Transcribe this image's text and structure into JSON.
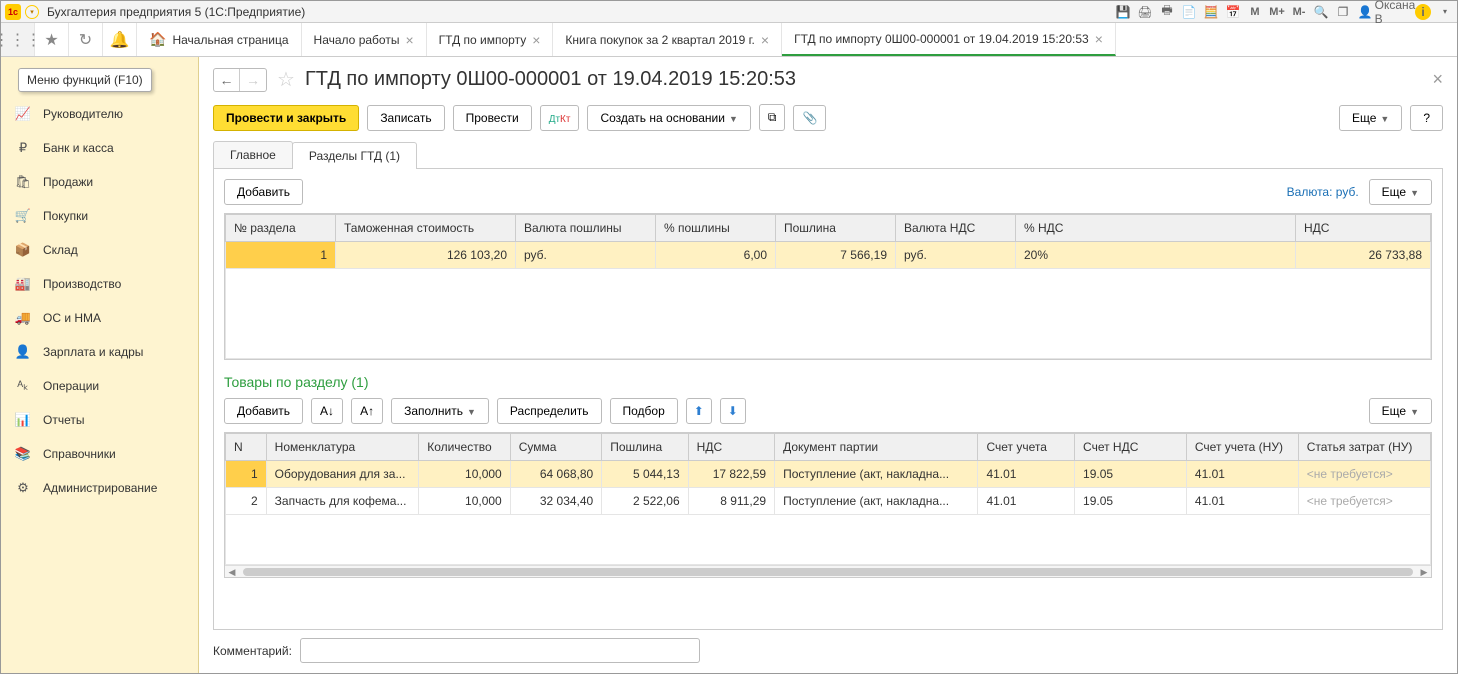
{
  "titlebar": {
    "app_title": "Бухгалтерия предприятия 5   (1С:Предприятие)",
    "user": "Оксана В"
  },
  "tooltip": "Меню функций (F10)",
  "tabs": {
    "home": "Начальная страница",
    "items": [
      {
        "label": "Начало работы"
      },
      {
        "label": "ГТД по импорту"
      },
      {
        "label": "Книга покупок за 2 квартал 2019 г."
      },
      {
        "label": "ГТД по импорту 0Ш00-000001 от 19.04.2019 15:20:53",
        "active": true
      }
    ]
  },
  "sidebar": {
    "items": [
      {
        "icon": "📈",
        "label": "Руководителю"
      },
      {
        "icon": "₽",
        "label": "Банк и касса"
      },
      {
        "icon": "🛍",
        "label": "Продажи"
      },
      {
        "icon": "🛒",
        "label": "Покупки"
      },
      {
        "icon": "📦",
        "label": "Склад"
      },
      {
        "icon": "🏭",
        "label": "Производство"
      },
      {
        "icon": "🚚",
        "label": "ОС и НМА"
      },
      {
        "icon": "👤",
        "label": "Зарплата и кадры"
      },
      {
        "icon": "ᴬₖ",
        "label": "Операции"
      },
      {
        "icon": "📊",
        "label": "Отчеты"
      },
      {
        "icon": "📚",
        "label": "Справочники"
      },
      {
        "icon": "⚙",
        "label": "Администрирование"
      }
    ]
  },
  "document": {
    "title": "ГТД по импорту 0Ш00-000001 от 19.04.2019 15:20:53",
    "actions": {
      "post_close": "Провести и закрыть",
      "save": "Записать",
      "post": "Провести",
      "create_based": "Создать на основании",
      "more": "Еще",
      "help": "?"
    },
    "inner_tabs": {
      "main": "Главное",
      "sections": "Разделы ГТД (1)"
    },
    "section_bar": {
      "add": "Добавить",
      "currency_label": "Валюта: руб.",
      "more": "Еще"
    },
    "sections_table": {
      "headers": [
        "№ раздела",
        "Таможенная стоимость",
        "Валюта пошлины",
        "% пошлины",
        "Пошлина",
        "Валюта НДС",
        "% НДС",
        "НДС"
      ],
      "rows": [
        {
          "n": "1",
          "cost": "126 103,20",
          "duty_cur": "руб.",
          "duty_pct": "6,00",
          "duty": "7 566,19",
          "vat_cur": "руб.",
          "vat_pct": "20%",
          "vat": "26 733,88"
        }
      ]
    },
    "goods_title": "Товары по разделу (1)",
    "goods_bar": {
      "add": "Добавить",
      "fill": "Заполнить",
      "distribute": "Распределить",
      "select": "Подбор",
      "more": "Еще"
    },
    "goods_table": {
      "headers": [
        "N",
        "Номенклатура",
        "Количество",
        "Сумма",
        "Пошлина",
        "НДС",
        "Документ партии",
        "Счет учета",
        "Счет НДС",
        "Счет учета (НУ)",
        "Статья затрат (НУ)"
      ],
      "rows": [
        {
          "n": "1",
          "nom": "Оборудования для за...",
          "qty": "10,000",
          "sum": "64 068,80",
          "duty": "5 044,13",
          "vat": "17 822,59",
          "batch": "Поступление (акт, накладна...",
          "acc": "41.01",
          "vat_acc": "19.05",
          "acc_nu": "41.01",
          "exp": "<не требуется>"
        },
        {
          "n": "2",
          "nom": "Запчасть для кофема...",
          "qty": "10,000",
          "sum": "32 034,40",
          "duty": "2 522,06",
          "vat": "8 911,29",
          "batch": "Поступление (акт, накладна...",
          "acc": "41.01",
          "vat_acc": "19.05",
          "acc_nu": "41.01",
          "exp": "<не требуется>"
        }
      ]
    },
    "comment_label": "Комментарий:"
  }
}
